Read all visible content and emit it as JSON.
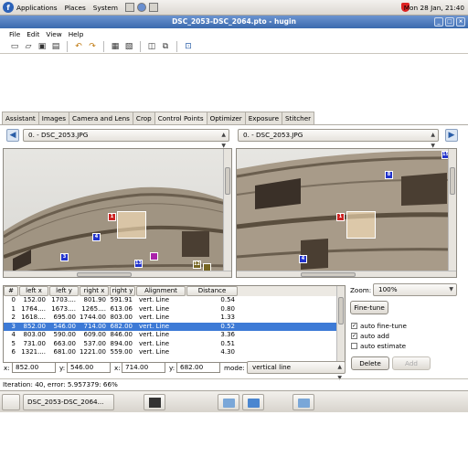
{
  "top_panel": {
    "menus": [
      "Applications",
      "Places",
      "System"
    ],
    "clock": "Mon 28 Jan, 21:40"
  },
  "window": {
    "title": "DSC_2053-DSC_2064.pto - hugin"
  },
  "menubar": [
    "File",
    "Edit",
    "View",
    "Help"
  ],
  "tabs": [
    "Assistant",
    "Images",
    "Camera and Lens",
    "Crop",
    "Control Points",
    "Optimizer",
    "Exposure",
    "Stitcher"
  ],
  "active_tab": "Control Points",
  "left_image": {
    "selected": "0. - DSC_2053.JPG"
  },
  "right_image": {
    "selected": "0. - DSC_2053.JPG"
  },
  "left_points": [
    "1",
    "4",
    "3",
    "13",
    "12"
  ],
  "right_points": [
    "15",
    "8",
    "1",
    "4"
  ],
  "table": {
    "headers": [
      "#",
      "left x",
      "left y",
      "right x",
      "right y",
      "Alignment",
      "Distance"
    ],
    "rows": [
      [
        "0",
        "152.00",
        "1703....",
        "801.90",
        "591.91",
        "vert. Line",
        "0.54"
      ],
      [
        "1",
        "1764....",
        "1673....",
        "1265....",
        "613.06",
        "vert. Line",
        "0.80"
      ],
      [
        "2",
        "1618....",
        "695.00",
        "1744.00",
        "803.00",
        "vert. Line",
        "1.33"
      ],
      [
        "3",
        "852.00",
        "546.00",
        "714.00",
        "682.00",
        "vert. Line",
        "0.52"
      ],
      [
        "4",
        "803.00",
        "590.00",
        "609.00",
        "846.00",
        "vert. Line",
        "3.36"
      ],
      [
        "5",
        "731.00",
        "663.00",
        "537.00",
        "894.00",
        "vert. Line",
        "0.51"
      ],
      [
        "6",
        "1321....",
        "681.00",
        "1221.00",
        "559.00",
        "vert. Line",
        "4.30"
      ]
    ],
    "selected_row": 3
  },
  "right_panel": {
    "zoom_label": "Zoom:",
    "zoom_value": "100%",
    "fine_tune": "Fine-tune",
    "auto_fine_tune": "auto fine-tune",
    "auto_add": "auto add",
    "auto_estimate": "auto estimate",
    "delete": "Delete",
    "add": "Add"
  },
  "coords": {
    "x_label": "x:",
    "x1": "852.00",
    "y_label": "y:",
    "y1": "546.00",
    "x2_label": "x:",
    "x2": "714.00",
    "y2_label": "y:",
    "y2": "682.00",
    "mode_label": "mode:",
    "mode": "vertical line"
  },
  "status": "Iteration: 40, error: 5.957379: 66%",
  "taskbar": {
    "task_label": "DSC_2053-DSC_2064..."
  }
}
